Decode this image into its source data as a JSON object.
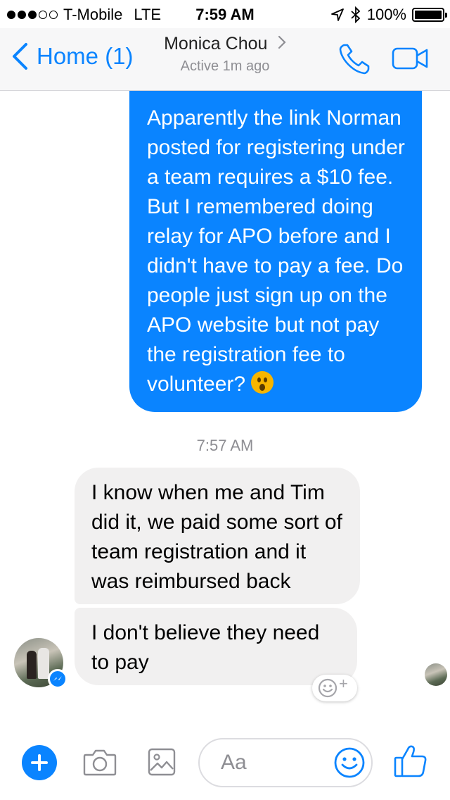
{
  "status_bar": {
    "carrier": "T-Mobile",
    "network": "LTE",
    "time": "7:59 AM",
    "battery": "100%"
  },
  "header": {
    "back_label": "Home (1)",
    "contact_name": "Monica Chou",
    "active_status": "Active 1m ago"
  },
  "messages": {
    "outgoing_text": "Apparently the link Norman posted for registering under a team requires a $10 fee. But I remembered doing relay for APO before and I didn't have to pay a fee. Do people just sign up on the APO website but not pay the registration fee to volunteer?",
    "outgoing_emoji": "wow-emoji",
    "timestamp": "7:57 AM",
    "incoming_1": "I know when me and Tim did it, we paid some sort of team registration and it was reimbursed back",
    "incoming_2": "I don't believe they need to pay",
    "reaction_plus": "+"
  },
  "composer": {
    "placeholder": "Aa"
  },
  "colors": {
    "accent": "#0a84ff",
    "incoming_bubble": "#f1f0f0",
    "header_bg": "#f7f7f8"
  },
  "icons": {
    "back": "chevron-left-icon",
    "phone": "phone-icon",
    "video": "video-camera-icon",
    "plus": "plus-icon",
    "camera": "camera-icon",
    "gallery": "photo-gallery-icon",
    "emoji": "smiley-icon",
    "like": "thumbs-up-icon"
  }
}
